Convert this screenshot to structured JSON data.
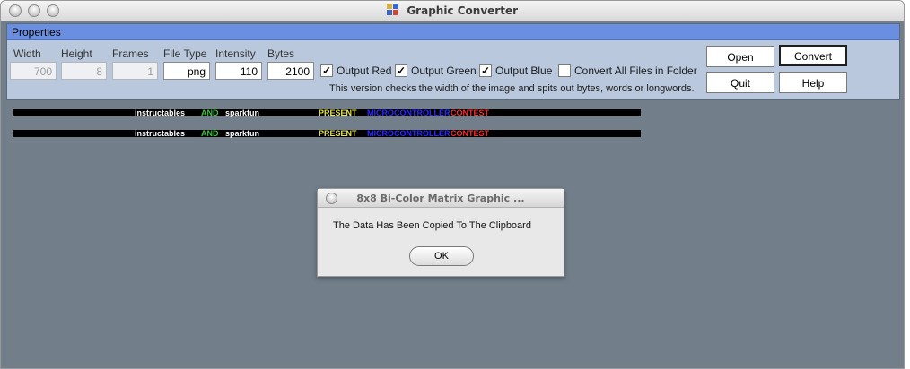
{
  "window": {
    "title": "Graphic Converter",
    "icon": "app-palette-icon"
  },
  "properties": {
    "header": "Properties",
    "fields": {
      "width": {
        "label": "Width",
        "value": "700",
        "enabled": false
      },
      "height": {
        "label": "Height",
        "value": "8",
        "enabled": false
      },
      "frames": {
        "label": "Frames",
        "value": "1",
        "enabled": false
      },
      "file_type": {
        "label": "File Type",
        "value": "png",
        "enabled": true
      },
      "intensity": {
        "label": "Intensity",
        "value": "110",
        "enabled": true
      },
      "bytes": {
        "label": "Bytes",
        "value": "2100",
        "enabled": true
      }
    },
    "checkboxes": {
      "output_red": {
        "label": "Output Red",
        "checked": true
      },
      "output_green": {
        "label": "Output Green",
        "checked": true
      },
      "output_blue": {
        "label": "Output Blue",
        "checked": true
      },
      "convert_all": {
        "label": "Convert All Files in Folder",
        "checked": false
      }
    },
    "check_mark": "✓",
    "note": "This version checks the width of the image and spits out bytes, words or longwords."
  },
  "buttons": {
    "open": "Open",
    "convert": "Convert",
    "quit": "Quit",
    "help": "Help"
  },
  "banner": {
    "words": {
      "instructables": "instructables",
      "and": "AND",
      "sparkfun": "sparkfun",
      "present": "PRESENT",
      "microcontroller": "MICROCONTROLLER",
      "contest": "CONTEST"
    },
    "colors": {
      "instructables": "#ffffff",
      "and": "#35c435",
      "sparkfun": "#ffffff",
      "present": "#e8e84a",
      "microcontroller": "#2a2aff",
      "contest": "#ff2a2a"
    }
  },
  "dialog": {
    "title": "8x8 Bi-Color Matrix Graphic ...",
    "message": "The Data Has Been Copied To The Clipboard",
    "ok_label": "OK"
  }
}
